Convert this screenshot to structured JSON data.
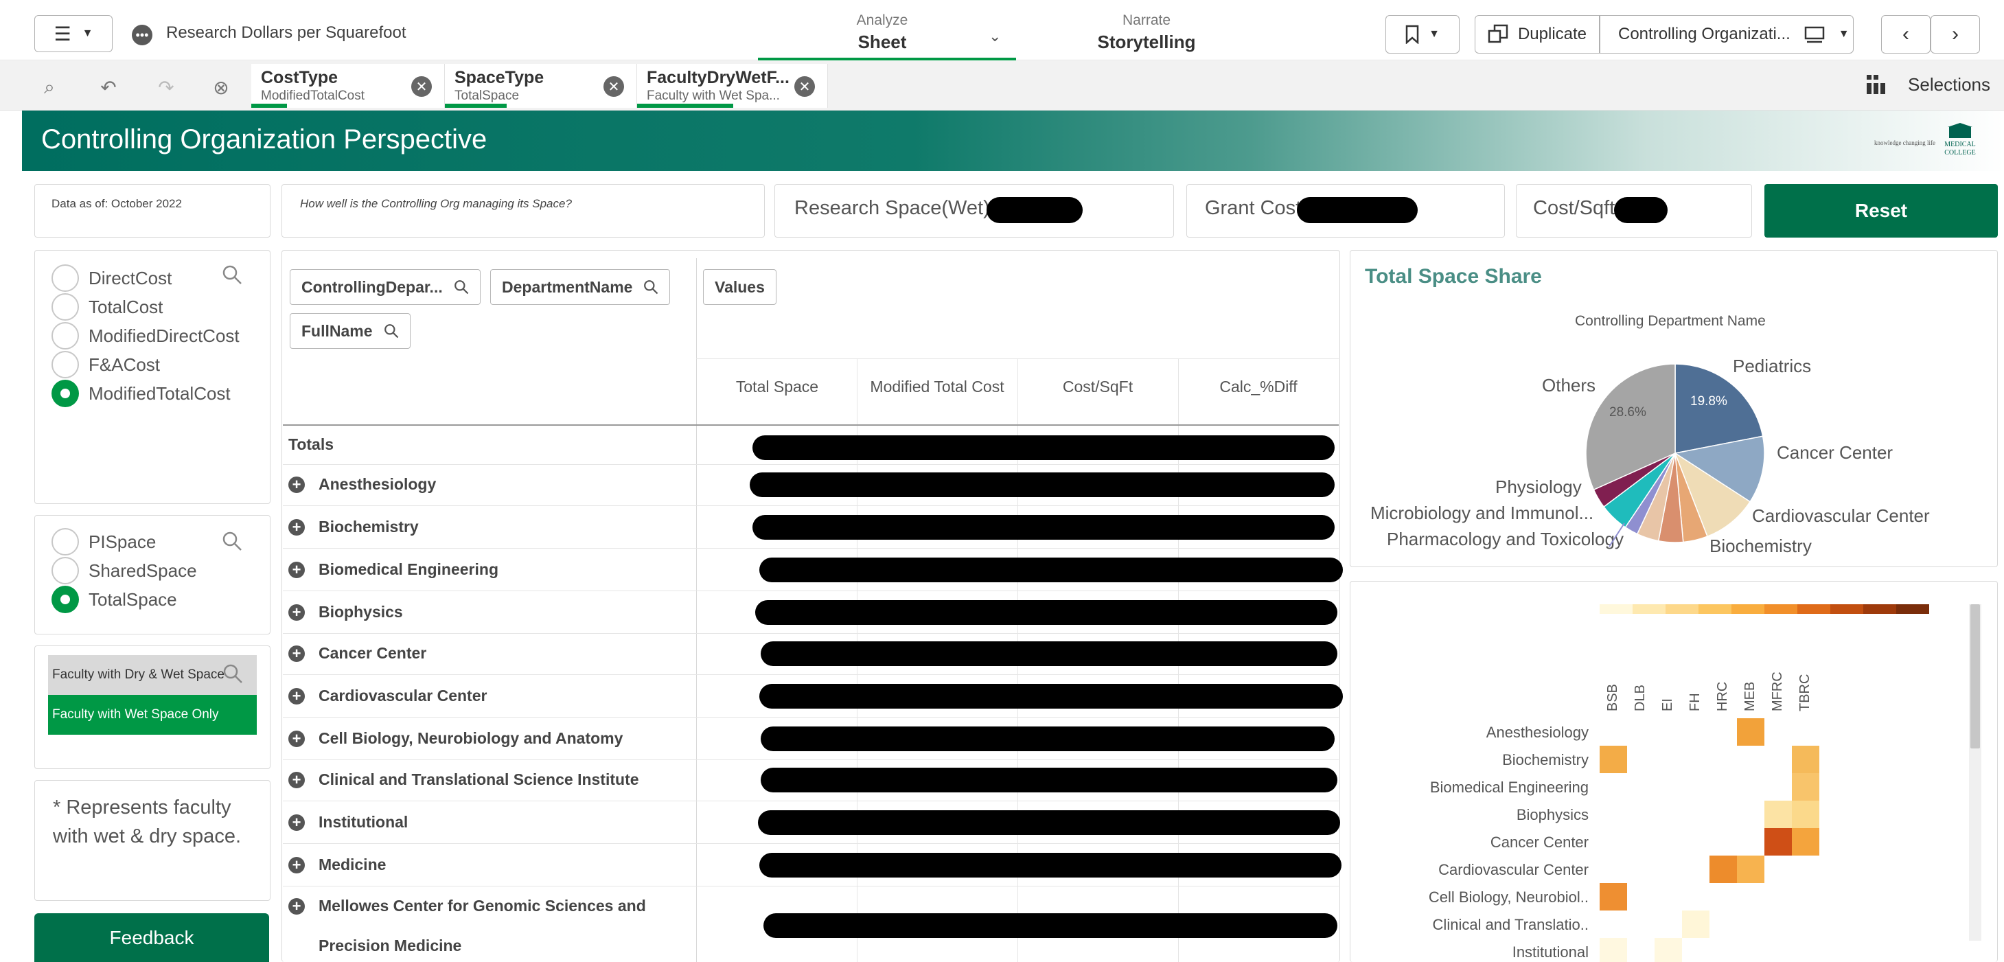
{
  "app": {
    "title": "Research Dollars per Squarefoot"
  },
  "nav": {
    "analyze_small": "Analyze",
    "analyze_big": "Sheet",
    "narrate_small": "Narrate",
    "narrate_big": "Storytelling"
  },
  "toolbar": {
    "duplicate": "Duplicate",
    "sheet_name": "Controlling Organizati..."
  },
  "selections": {
    "label": "Selections",
    "chips": [
      {
        "field": "CostType",
        "value": "ModifiedTotalCost"
      },
      {
        "field": "SpaceType",
        "value": "TotalSpace"
      },
      {
        "field": "FacultyDryWetF...",
        "value": "Faculty with Wet Spa..."
      }
    ]
  },
  "banner": {
    "title": "Controlling Organization Perspective",
    "logo_tagline": "knowledge changing life",
    "logo_name": "MEDICAL COLLEGE OF WISCONSIN"
  },
  "info": {
    "data_as_of": "Data as of: October 2022",
    "question": "How well is the Controlling Org managing its Space?",
    "kpi_space": "Research Space(Wet) :",
    "kpi_grant": "Grant Cost",
    "kpi_cost": "Cost/Sqft",
    "reset": "Reset"
  },
  "cost_filter": {
    "options": [
      "DirectCost",
      "TotalCost",
      "ModifiedDirectCost",
      "F&ACost",
      "ModifiedTotalCost"
    ],
    "selected": "ModifiedTotalCost"
  },
  "space_filter": {
    "options": [
      "PISpace",
      "SharedSpace",
      "TotalSpace"
    ],
    "selected": "TotalSpace"
  },
  "faculty_filter": {
    "dry_wet": "Faculty with Dry & Wet Space",
    "wet_only": "Faculty with Wet Space Only"
  },
  "note": {
    "line1": "* Represents faculty",
    "line2": "with wet & dry space."
  },
  "feedback": "Feedback",
  "pivot": {
    "dims": [
      "ControllingDepar...",
      "DepartmentName",
      "FullName"
    ],
    "values_pill": "Values",
    "columns": [
      "Total Space",
      "Modified Total Cost",
      "Cost/SqFt",
      "Calc_%Diff"
    ],
    "totals_label": "Totals",
    "rows": [
      "Anesthesiology",
      "Biochemistry",
      "Biomedical Engineering",
      "Biophysics",
      "Cancer Center",
      "Cardiovascular Center",
      "Cell Biology, Neurobiology and Anatomy",
      "Clinical and Translational Science Institute",
      "Institutional",
      "Medicine",
      "Mellowes Center for Genomic Sciences and",
      "Precision Medicine"
    ]
  },
  "pie": {
    "title": "Total Space Share",
    "subtitle": "Controlling Department Name",
    "labels": {
      "pediatrics": "Pediatrics",
      "cancer": "Cancer Center",
      "cardio": "Cardiovascular Center",
      "biochem": "Biochemistry",
      "pharm": "Pharmacology and Toxicology",
      "micro": "Microbiology and Immunol...",
      "physio": "Physiology",
      "others": "Others",
      "pct_pediatrics": "19.8%",
      "pct_others": "28.6%"
    }
  },
  "chart_data": [
    {
      "type": "pie",
      "subtitle": "Controlling Department Name",
      "slices": [
        {
          "label": "Pediatrics",
          "value": 19.8,
          "color": "#4f6f95"
        },
        {
          "label": "Cancer Center",
          "value": 11.0,
          "color": "#8ea8c4"
        },
        {
          "label": "Cardiovascular Center",
          "value": 9.0,
          "color": "#efdcb6"
        },
        {
          "label": "",
          "value": 4.0,
          "color": "#e7a774"
        },
        {
          "label": "Biochemistry",
          "value": 4.0,
          "color": "#d98f6e"
        },
        {
          "label": "",
          "value": 3.6,
          "color": "#e8c5a7"
        },
        {
          "label": "Pharmacology and Toxicology",
          "value": 2.2,
          "color": "#8f8fd0"
        },
        {
          "label": "Microbiology and Immunol...",
          "value": 4.8,
          "color": "#1fbcbc"
        },
        {
          "label": "Physiology",
          "value": 3.2,
          "color": "#801f50"
        },
        {
          "label": "Others",
          "value": 28.6,
          "color": "#a5a5a5"
        }
      ]
    },
    {
      "type": "heatmap",
      "x": [
        "BSB",
        "DLB",
        "EI",
        "FH",
        "HRC",
        "MEB",
        "MFRC",
        "TBRC"
      ],
      "y": [
        "Anesthesiology",
        "Biochemistry",
        "Biomedical Engineering",
        "Biophysics",
        "Cancer Center",
        "Cardiovascular Center",
        "Cell Biology, Neurobiol..",
        "Clinical and Translatio..",
        "Institutional"
      ],
      "cells": [
        {
          "row": 0,
          "col": 5,
          "color": "#f2a23a"
        },
        {
          "row": 1,
          "col": 0,
          "color": "#f3ac47"
        },
        {
          "row": 1,
          "col": 7,
          "color": "#f5ba5a"
        },
        {
          "row": 2,
          "col": 7,
          "color": "#f8c46b"
        },
        {
          "row": 3,
          "col": 6,
          "color": "#fce3a4"
        },
        {
          "row": 3,
          "col": 7,
          "color": "#fbd98b"
        },
        {
          "row": 4,
          "col": 6,
          "color": "#cf4f16"
        },
        {
          "row": 4,
          "col": 7,
          "color": "#f4a43d"
        },
        {
          "row": 5,
          "col": 4,
          "color": "#ed8c2c"
        },
        {
          "row": 5,
          "col": 5,
          "color": "#f7b34f"
        },
        {
          "row": 6,
          "col": 0,
          "color": "#ee8f32"
        },
        {
          "row": 7,
          "col": 3,
          "color": "#fff6d8"
        },
        {
          "row": 8,
          "col": 0,
          "color": "#fff8e0"
        },
        {
          "row": 8,
          "col": 2,
          "color": "#fff8e0"
        }
      ],
      "legend_colors": [
        "#fff8dc",
        "#fee9b0",
        "#fdd88a",
        "#fcc660",
        "#f9ad3e",
        "#f18f2a",
        "#df6b19",
        "#c24f10",
        "#9e3a0b",
        "#7a2d0a"
      ]
    }
  ]
}
